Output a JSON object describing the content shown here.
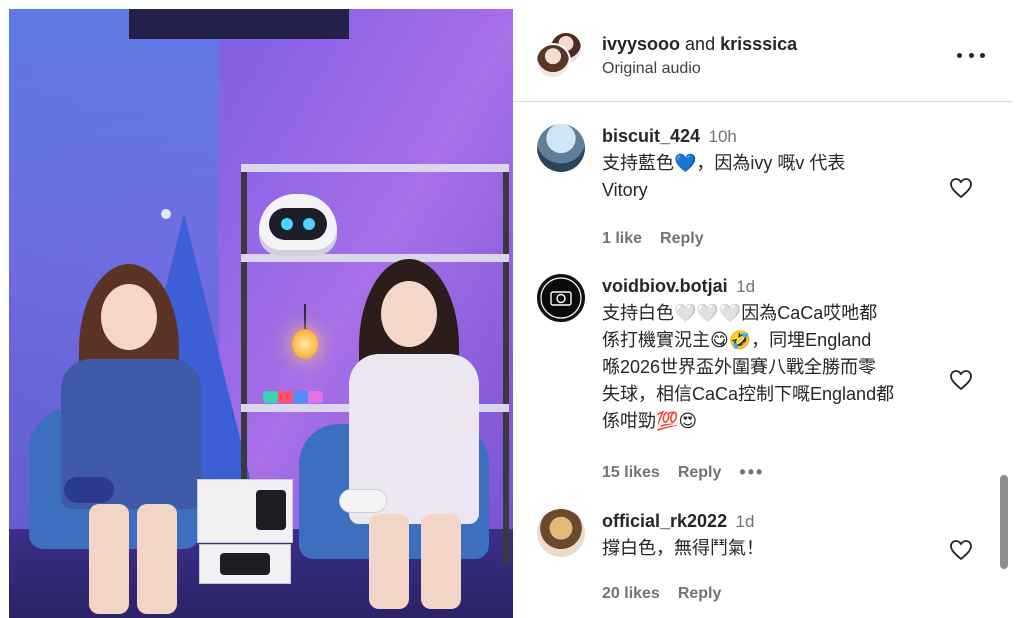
{
  "post": {
    "authors": {
      "first": "ivyysooo",
      "connector": "and",
      "second": "krisssica"
    },
    "audio_label": "Original audio"
  },
  "comments": [
    {
      "username": "biscuit_424",
      "time": "10h",
      "text_lines": [
        "支持藍色💙，因為ivy 嘅v 代表",
        "Vitory"
      ],
      "likes": "1 like",
      "reply": "Reply"
    },
    {
      "username": "voidbiov.botjai",
      "time": "1d",
      "text_lines": [
        "支持白色🤍🤍🤍因為CaCa哎吔都",
        "係打機實況主😋🤣，同埋England",
        "喺2026世界盃外圍賽八戰全勝而零",
        "失球，相信CaCa控制下嘅England都",
        "係咁勁💯😍"
      ],
      "likes": "15 likes",
      "reply": "Reply",
      "more": "•••"
    },
    {
      "username": "official_rk2022",
      "time": "1d",
      "text_lines": [
        "撐白色，無得鬥氣！"
      ],
      "likes": "20 likes",
      "reply": "Reply"
    }
  ],
  "icons": {
    "more": "more-horizontal-icon",
    "like": "heart-outline-icon"
  },
  "colors": {
    "text_primary": "#262626",
    "text_secondary": "#737373",
    "divider": "#dbdbdb"
  }
}
